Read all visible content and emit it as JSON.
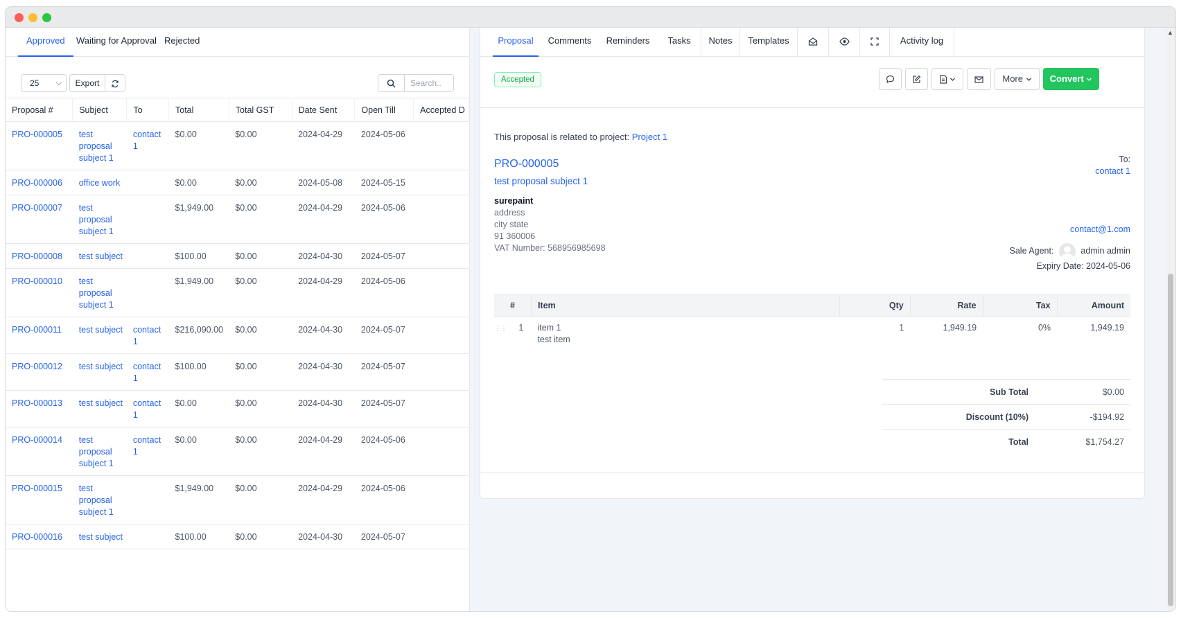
{
  "left": {
    "tabs": [
      "Approved",
      "Waiting for Approval",
      "Rejected"
    ],
    "page_size": "25",
    "export_label": "Export",
    "search_placeholder": "Search..",
    "columns": [
      "Proposal #",
      "Subject",
      "To",
      "Total",
      "Total GST",
      "Date Sent",
      "Open Till",
      "Accepted D"
    ],
    "rows": [
      {
        "num": "PRO-000005",
        "subject": "test proposal subject 1",
        "to": "contact 1",
        "total": "$0.00",
        "gst": "$0.00",
        "sent": "2024-04-29",
        "till": "2024-05-06"
      },
      {
        "num": "PRO-000006",
        "subject": "office work",
        "to": "",
        "total": "$0.00",
        "gst": "$0.00",
        "sent": "2024-05-08",
        "till": "2024-05-15"
      },
      {
        "num": "PRO-000007",
        "subject": "test proposal subject 1",
        "to": "",
        "total": "$1,949.00",
        "gst": "$0.00",
        "sent": "2024-04-29",
        "till": "2024-05-06"
      },
      {
        "num": "PRO-000008",
        "subject": "test subject",
        "to": "",
        "total": "$100.00",
        "gst": "$0.00",
        "sent": "2024-04-30",
        "till": "2024-05-07"
      },
      {
        "num": "PRO-000010",
        "subject": "test proposal subject 1",
        "to": "",
        "total": "$1,949.00",
        "gst": "$0.00",
        "sent": "2024-04-29",
        "till": "2024-05-06"
      },
      {
        "num": "PRO-000011",
        "subject": "test subject",
        "to": "contact 1",
        "total": "$216,090.00",
        "gst": "$0.00",
        "sent": "2024-04-30",
        "till": "2024-05-07"
      },
      {
        "num": "PRO-000012",
        "subject": "test subject",
        "to": "contact 1",
        "total": "$100.00",
        "gst": "$0.00",
        "sent": "2024-04-30",
        "till": "2024-05-07"
      },
      {
        "num": "PRO-000013",
        "subject": "test subject",
        "to": "contact 1",
        "total": "$0.00",
        "gst": "$0.00",
        "sent": "2024-04-30",
        "till": "2024-05-07"
      },
      {
        "num": "PRO-000014",
        "subject": "test proposal subject 1",
        "to": "contact 1",
        "total": "$0.00",
        "gst": "$0.00",
        "sent": "2024-04-29",
        "till": "2024-05-06"
      },
      {
        "num": "PRO-000015",
        "subject": "test proposal subject 1",
        "to": "",
        "total": "$1,949.00",
        "gst": "$0.00",
        "sent": "2024-04-29",
        "till": "2024-05-06"
      },
      {
        "num": "PRO-000016",
        "subject": "test subject",
        "to": "",
        "total": "$100.00",
        "gst": "$0.00",
        "sent": "2024-04-30",
        "till": "2024-05-07"
      }
    ]
  },
  "right": {
    "tabs": {
      "proposal": "Proposal",
      "comments": "Comments",
      "reminders": "Reminders",
      "tasks": "Tasks",
      "notes": "Notes",
      "templates": "Templates",
      "activity": "Activity log"
    },
    "icons": {
      "open_envelope": "envelope-open-icon",
      "view": "eye-icon",
      "fullscreen": "expand-icon",
      "comment": "comment-icon",
      "edit": "edit-icon",
      "pdf": "pdf-icon",
      "email": "envelope-icon"
    },
    "status": "Accepted",
    "more_label": "More",
    "convert_label": "Convert",
    "related_text": "This proposal is related to project:",
    "related_project": "Project 1",
    "proposal_number": "PRO-000005",
    "proposal_subject": "test proposal subject 1",
    "company": {
      "name": "surepaint",
      "address": "address",
      "city_state": "city state",
      "zip": "91 360006",
      "vat": "VAT Number: 568956985698"
    },
    "to_label": "To:",
    "to_contact": "contact 1",
    "email": "contact@1.com",
    "sale_agent_label": "Sale Agent:",
    "sale_agent": "admin admin",
    "expiry": "Expiry Date: 2024-05-06",
    "item_headers": [
      "#",
      "Item",
      "Qty",
      "Rate",
      "Tax",
      "Amount"
    ],
    "items": [
      {
        "num": "1",
        "name": "item 1",
        "desc": "test item",
        "qty": "1",
        "rate": "1,949.19",
        "tax": "0%",
        "amount": "1,949.19"
      }
    ],
    "totals": [
      {
        "label": "Sub Total",
        "value": "$0.00"
      },
      {
        "label": "Discount (10%)",
        "value": "-$194.92"
      },
      {
        "label": "Total",
        "value": "$1,754.27"
      }
    ]
  },
  "colors": {
    "accent": "#2563eb",
    "success": "#22c55e"
  }
}
